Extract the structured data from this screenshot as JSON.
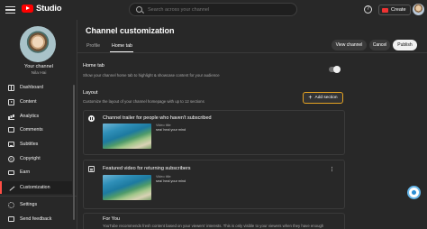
{
  "header": {
    "logo_text": "Studio",
    "search_placeholder": "Search across your channel",
    "help_glyph": "?",
    "create_label": "Create"
  },
  "sidebar": {
    "channel_label": "Your channel",
    "channel_name": "Nila Hai",
    "items": [
      {
        "label": "Dashboard",
        "icon": "dashboard-icon"
      },
      {
        "label": "Content",
        "icon": "content-icon"
      },
      {
        "label": "Analytics",
        "icon": "analytics-icon"
      },
      {
        "label": "Comments",
        "icon": "comments-icon"
      },
      {
        "label": "Subtitles",
        "icon": "subtitles-icon"
      },
      {
        "label": "Copyright",
        "icon": "copyright-icon"
      },
      {
        "label": "Earn",
        "icon": "earn-icon"
      },
      {
        "label": "Customization",
        "icon": "customization-icon",
        "active": true
      },
      {
        "label": "Settings",
        "icon": "settings-icon"
      },
      {
        "label": "Send feedback",
        "icon": "feedback-icon"
      }
    ]
  },
  "main": {
    "title": "Channel customization",
    "tabs": [
      {
        "label": "Profile"
      },
      {
        "label": "Home tab",
        "active": true
      }
    ],
    "buttons": {
      "view_channel": "View channel",
      "cancel": "Cancel",
      "publish": "Publish"
    },
    "home_tab": {
      "title": "Home tab",
      "desc": "Show your channel home tab to highlight & showcase content for your audience",
      "enabled": true
    },
    "layout": {
      "title": "Layout",
      "desc": "Customize the layout of your channel homepage with up to 12 sections",
      "add_section": "Add section"
    },
    "sections": [
      {
        "title": "Channel trailer for people who haven't subscribed",
        "video_label": "Video title",
        "video_title": "sea/ heal your mind"
      },
      {
        "title": "Featured video for returning subscribers",
        "video_label": "Video title",
        "video_title": "sea/ heal your mind"
      },
      {
        "title": "For You",
        "desc": "YouTube recommends fresh content based on your viewers' interests. This is only visible to your viewers when they have enough"
      }
    ]
  },
  "colors": {
    "accent_red": "#ff0000",
    "active_marker": "#ff4e45",
    "highlight_border": "#e5a322"
  }
}
